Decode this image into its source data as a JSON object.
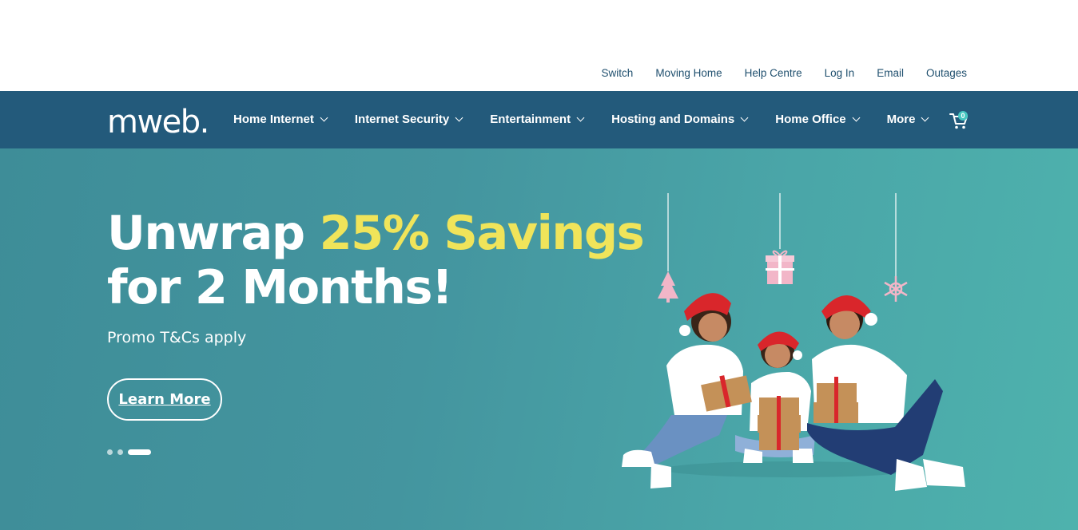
{
  "utility_nav": [
    "Switch",
    "Moving Home",
    "Help Centre",
    "Log In",
    "Email",
    "Outages"
  ],
  "brand": {
    "logo_text": "mweb."
  },
  "main_nav": [
    {
      "label": "Home Internet"
    },
    {
      "label": "Internet Security"
    },
    {
      "label": "Entertainment"
    },
    {
      "label": "Hosting and Domains"
    },
    {
      "label": "Home Office"
    },
    {
      "label": "More"
    }
  ],
  "cart": {
    "count": "0",
    "icon": "cart-icon"
  },
  "hero": {
    "headline_part1": "Unwrap ",
    "headline_highlight": "25% Savings",
    "headline_line2": "for 2 Months!",
    "subtext": "Promo T&Cs apply",
    "cta_label": "Learn More",
    "slides_total": 3,
    "active_slide": 3
  },
  "colors": {
    "nav_bg": "#235a7b",
    "hero_bg": "#4aa6a8",
    "highlight": "#f0e45a",
    "utility_link": "#1f4f6e"
  }
}
